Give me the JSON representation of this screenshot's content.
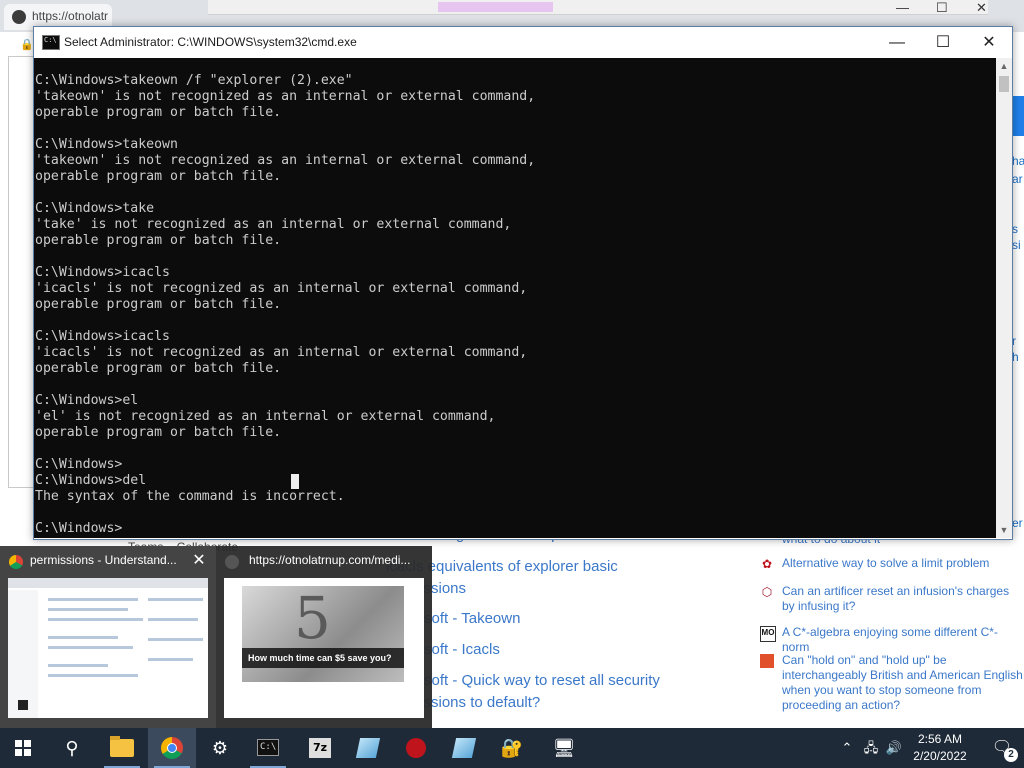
{
  "background_browser": {
    "tab_label": "https://otnolatr",
    "lock_icon": "lock-icon",
    "right_fragments": [
      "ha",
      "ar",
      "s",
      "si",
      "r",
      "h",
      "er"
    ]
  },
  "page_links": {
    "fragment_top": "SU - Change owner and permissions on folder",
    "items": [
      "icacls equivalents of explorer basic",
      "permissions",
      "soft - Takeown",
      "soft - Icacls",
      "soft - Quick way to reset all security",
      "permissions to default?"
    ]
  },
  "hot_questions": [
    {
      "icon": "red-flower-icon",
      "text": "Alternative way to solve a limit problem"
    },
    {
      "icon": "dnd-icon",
      "text": "Can an artificer reset an infusion's charges by infusing it?"
    },
    {
      "icon": "mo-icon",
      "text": "A C*-algebra enjoying some different C*-norm"
    },
    {
      "icon": "bookmark-icon",
      "text": "Can \"hold on\" and \"hold up\" be interchangeably British and American English when you want to stop someone from proceeding an action?"
    }
  ],
  "hot_question_fragment": "what to do about it",
  "teams_fragment": "Teams – Collaborate",
  "cmd": {
    "title": "Select Administrator: C:\\WINDOWS\\system32\\cmd.exe",
    "lines": [
      "C:\\Windows>takeown /f \"explorer (2).exe\"",
      "'takeown' is not recognized as an internal or external command,",
      "operable program or batch file.",
      "",
      "C:\\Windows>takeown",
      "'takeown' is not recognized as an internal or external command,",
      "operable program or batch file.",
      "",
      "C:\\Windows>take",
      "'take' is not recognized as an internal or external command,",
      "operable program or batch file.",
      "",
      "C:\\Windows>icacls",
      "'icacls' is not recognized as an internal or external command,",
      "operable program or batch file.",
      "",
      "C:\\Windows>icacls",
      "'icacls' is not recognized as an internal or external command,",
      "operable program or batch file.",
      "",
      "C:\\Windows>el",
      "'el' is not recognized as an internal or external command,",
      "operable program or batch file.",
      "",
      "C:\\Windows>",
      "C:\\Windows>del",
      "The syntax of the command is incorrect.",
      "",
      "C:\\Windows>"
    ],
    "minimize_glyph": "—",
    "maximize_glyph": "☐",
    "close_glyph": "✕"
  },
  "thumbnails": [
    {
      "title": "permissions - Understand...",
      "icon": "chrome-icon",
      "active": true
    },
    {
      "title": "https://otnolatrnup.com/medi...",
      "icon": "globe-icon",
      "active": false,
      "caption": "How much time can $5 save you?"
    }
  ],
  "taskbar": {
    "time": "2:56 AM",
    "date": "2/20/2022",
    "notification_count": "2",
    "items": [
      "start",
      "search",
      "file-explorer",
      "chrome",
      "settings",
      "cmd",
      "7zip",
      "app-blue",
      "app-red",
      "app-blue-2",
      "app-security",
      "app-monitor"
    ]
  }
}
